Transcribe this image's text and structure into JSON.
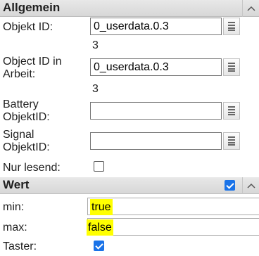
{
  "sections": {
    "allgemein": {
      "title": "Allgemein"
    },
    "wert": {
      "title": "Wert",
      "enabled": true
    }
  },
  "fields": {
    "objekt_id": {
      "label": "Objekt ID:",
      "value": "0_userdata.0.3",
      "caption": "3"
    },
    "object_id_in_arbeit": {
      "label_line1": "Object ID in",
      "label_line2": "Arbeit:",
      "value": "0_userdata.0.3",
      "caption": "3"
    },
    "battery_objekt_id": {
      "label_line1": "Battery",
      "label_line2": "ObjektID:",
      "value": ""
    },
    "signal_objekt_id": {
      "label_line1": "Signal",
      "label_line2": "ObjektID:",
      "value": ""
    },
    "nur_lesend": {
      "label": "Nur lesend:",
      "checked": false
    },
    "min": {
      "label": "min:",
      "value": "true"
    },
    "max": {
      "label": "max:",
      "value": "false"
    },
    "taster": {
      "label": "Taster:",
      "checked": true
    }
  },
  "colors": {
    "highlight": "#ffff00",
    "checkbox_checked": "#1a73e8",
    "header_bg": "#dedede"
  },
  "icons": {
    "collapse": "chevron-up-icon",
    "select": "list-icon"
  }
}
